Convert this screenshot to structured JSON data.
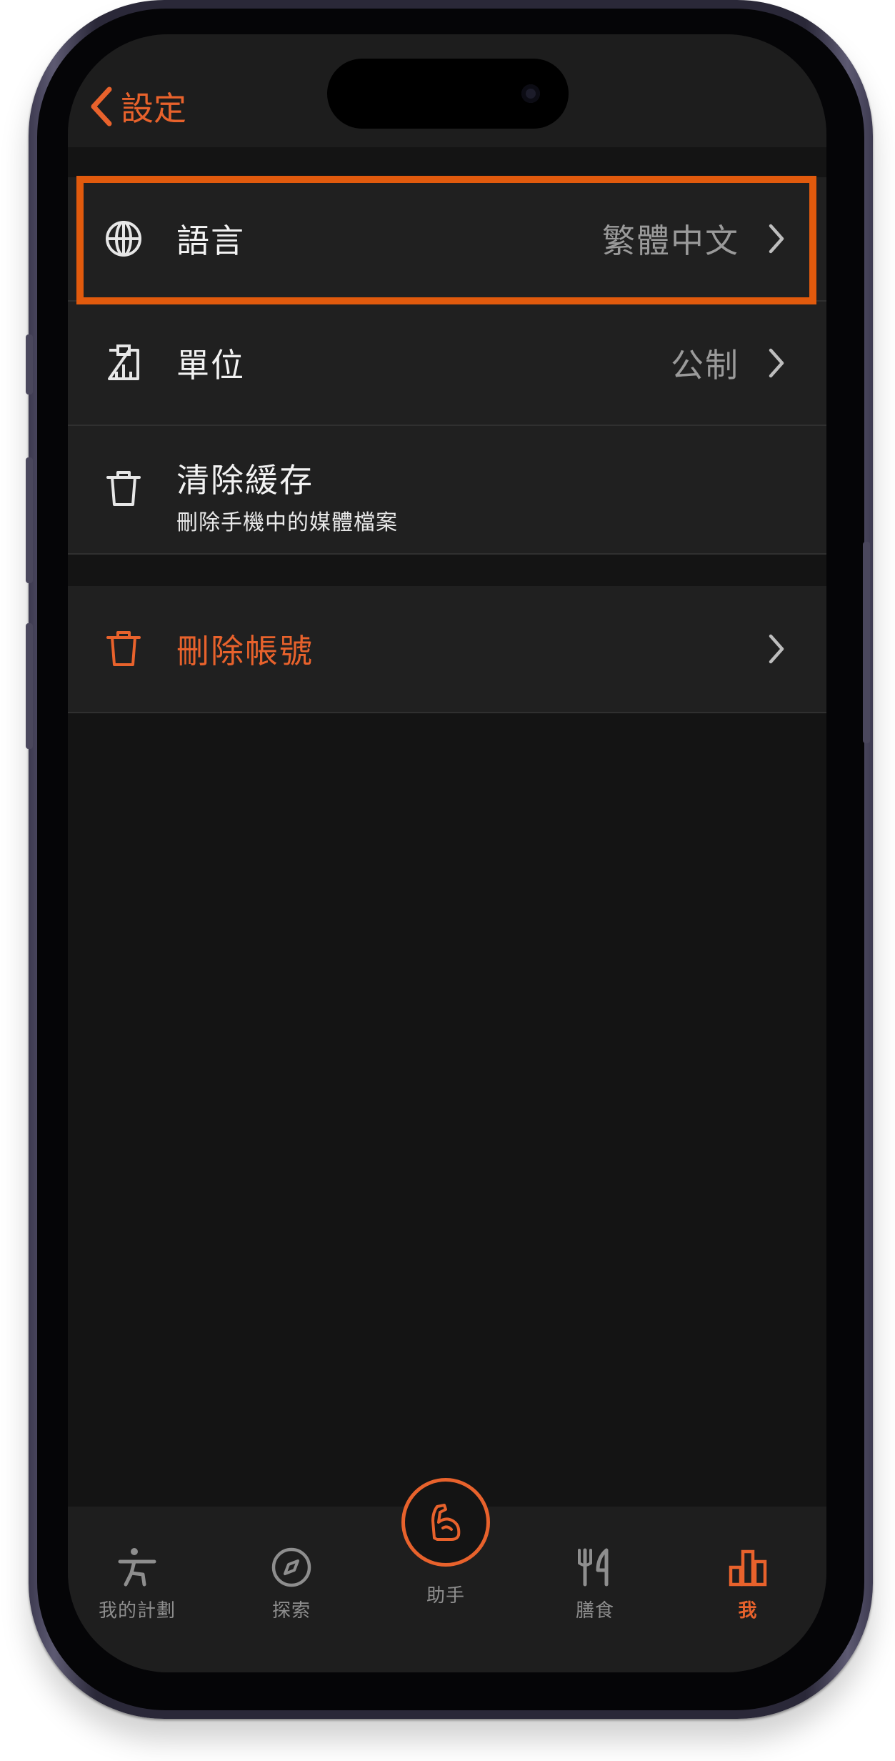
{
  "nav": {
    "back_label": "設定"
  },
  "settings": {
    "language": {
      "label": "語言",
      "value": "繁體中文"
    },
    "units": {
      "label": "單位",
      "value": "公制"
    },
    "clear_cache": {
      "label": "清除緩存",
      "subtitle": "刪除手機中的媒體檔案"
    },
    "delete_account": {
      "label": "刪除帳號"
    }
  },
  "tabbar": {
    "tabs": [
      {
        "label": "我的計劃",
        "icon": "exercise-icon"
      },
      {
        "label": "探索",
        "icon": "compass-icon"
      },
      {
        "label": "助手",
        "icon": "muscle-arm-icon"
      },
      {
        "label": "膳食",
        "icon": "fork-knife-icon"
      },
      {
        "label": "我",
        "icon": "bar-chart-icon",
        "active": true
      }
    ]
  },
  "colors": {
    "accent": "#e8622c",
    "highlight": "#e15a0d",
    "background": "#141414",
    "row": "#202020"
  }
}
